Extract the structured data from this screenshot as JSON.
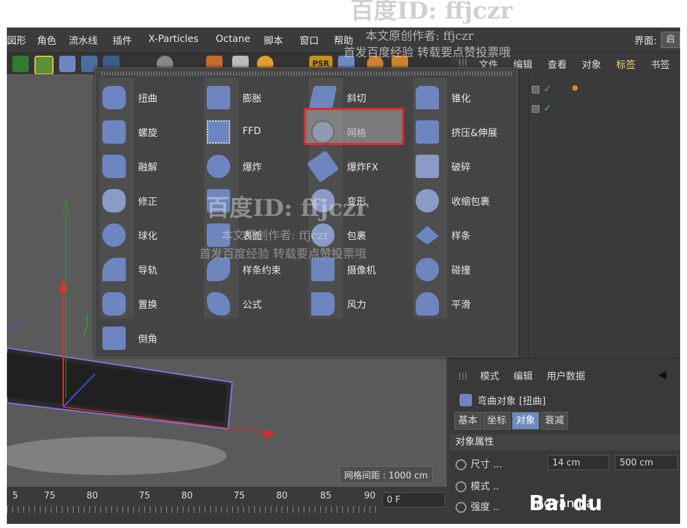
{
  "menubar": {
    "items": [
      "図形",
      "角色",
      "流水线",
      "插件",
      "X-Particles",
      "Octane",
      "脚本",
      "窗口",
      "帮助"
    ],
    "interface_label": "界面:",
    "interface_value": "启"
  },
  "panel_tabs": [
    "文件",
    "编辑",
    "查看",
    "对象",
    "标签",
    "书签"
  ],
  "deformers": {
    "col1": [
      "扭曲",
      "螺旋",
      "融解",
      "修正",
      "球化",
      "导轨",
      "置换",
      "倒角"
    ],
    "col2": [
      "膨胀",
      "FFD",
      "爆炸",
      "",
      "表面",
      "样条约束",
      "公式"
    ],
    "col3": [
      "斜切",
      "网格",
      "爆炸FX",
      "变形",
      "包裹",
      "摄像机",
      "风力"
    ],
    "col4": [
      "锥化",
      "挤压&伸展",
      "破碎",
      "收缩包裹",
      "样条",
      "碰撞",
      "平滑"
    ],
    "selected": "斜切"
  },
  "viewport": {
    "grid_spacing": "网格间距 : 1000 cm"
  },
  "timeline": {
    "ticks": [
      "5",
      "75",
      "80",
      "75",
      "80",
      "75",
      "80",
      "85",
      "90"
    ],
    "frame_field": "0 F"
  },
  "attributes": {
    "menu": [
      "模式",
      "编辑",
      "用户数据"
    ],
    "object_title": "弯曲对象 [扭曲]",
    "tabs": [
      "基本",
      "坐标",
      "对象",
      "衰减"
    ],
    "active_tab": "对象",
    "section": "对象属性",
    "params": [
      {
        "label": "尺寸 ...",
        "values": [
          "14 cm",
          "500 cm"
        ]
      },
      {
        "label": "模式 ..",
        "values": []
      },
      {
        "label": "强度 ..",
        "values": []
      }
    ]
  },
  "watermarks": {
    "id_big": "百度ID: ffjczr",
    "author": "本文原创作者: ffjczr",
    "note": "首发百度经验 转载要点赞投票哦",
    "baidu": "Bai du",
    "url": "ngyan.ba"
  },
  "colors": {
    "accent_blue": "#6d8cc0",
    "highlight_red": "#e02a2a",
    "tab_active": "#f2d37a"
  }
}
